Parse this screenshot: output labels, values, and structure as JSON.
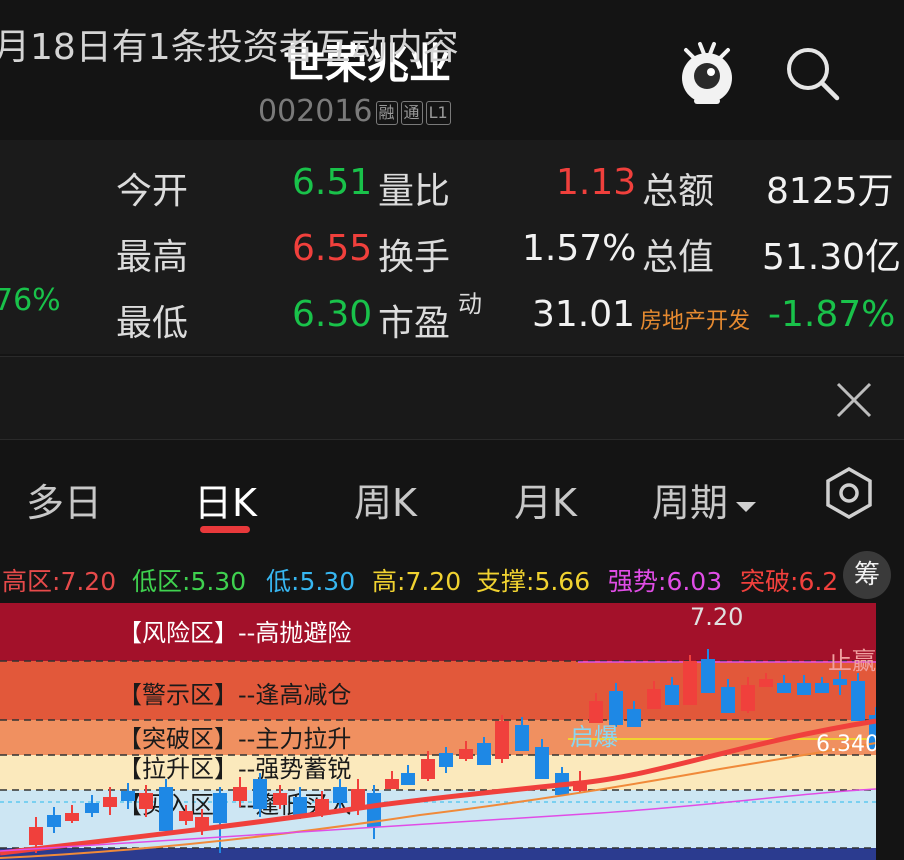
{
  "header": {
    "title": "世荣兆业",
    "code": "002016",
    "tags": [
      "融",
      "通",
      "L1"
    ]
  },
  "quote": {
    "left_partial": "76%",
    "rows": [
      {
        "l1": "今开",
        "v1": "6.51",
        "l2": "量比",
        "v2": "1.13",
        "l3": "总额",
        "v3": "8125万"
      },
      {
        "l1": "最高",
        "v1": "6.55",
        "l2": "换手",
        "v2": "1.57%",
        "l3": "总值",
        "v3": "51.30亿"
      },
      {
        "l1": "最低",
        "v1": "6.30",
        "l2": "市盈",
        "l2_sup": "动",
        "v2": "31.01",
        "l3": "房地产开发",
        "v3": "-1.87%"
      }
    ]
  },
  "notice": {
    "text": "月18日有1条投资者互动内容"
  },
  "tabs": [
    "多日",
    "日K",
    "周K",
    "月K",
    "周期"
  ],
  "indicators": [
    {
      "label": "高区:",
      "value": "7.20",
      "color": "#e64a4a"
    },
    {
      "label": "低区:",
      "value": "5.30",
      "color": "#3fd14f"
    },
    {
      "label": "低:",
      "value": "5.30",
      "color": "#37b6f0"
    },
    {
      "label": "高:",
      "value": "7.20",
      "color": "#f0d230"
    },
    {
      "label": "支撑:",
      "value": "5.66",
      "color": "#f0d230"
    },
    {
      "label": "强势:",
      "value": "6.03",
      "color": "#e04de6"
    },
    {
      "label": "突破:",
      "value": "6.2",
      "color": "#f0403c"
    }
  ],
  "chip": "筹",
  "zones": [
    {
      "label": "【风险区】--高抛避险"
    },
    {
      "label": "【警示区】--逢高减仓"
    },
    {
      "label": "【突破区】--主力拉升"
    },
    {
      "label": "【拉升区】--强势蓄锐"
    },
    {
      "label": "【买入区】--逢低买入"
    }
  ],
  "chart_annotations": {
    "high": "7.20",
    "sell_signal": "止赢",
    "start_signal": "启爆",
    "price": "6.340"
  },
  "colors": {
    "up": "#f0403c",
    "down": "#19c24a",
    "zone_risk": "#a3112a",
    "zone_warn": "#e2583a",
    "zone_break": "#f09060",
    "zone_rise": "#fbe9bc",
    "zone_buy": "#cde6f3"
  }
}
